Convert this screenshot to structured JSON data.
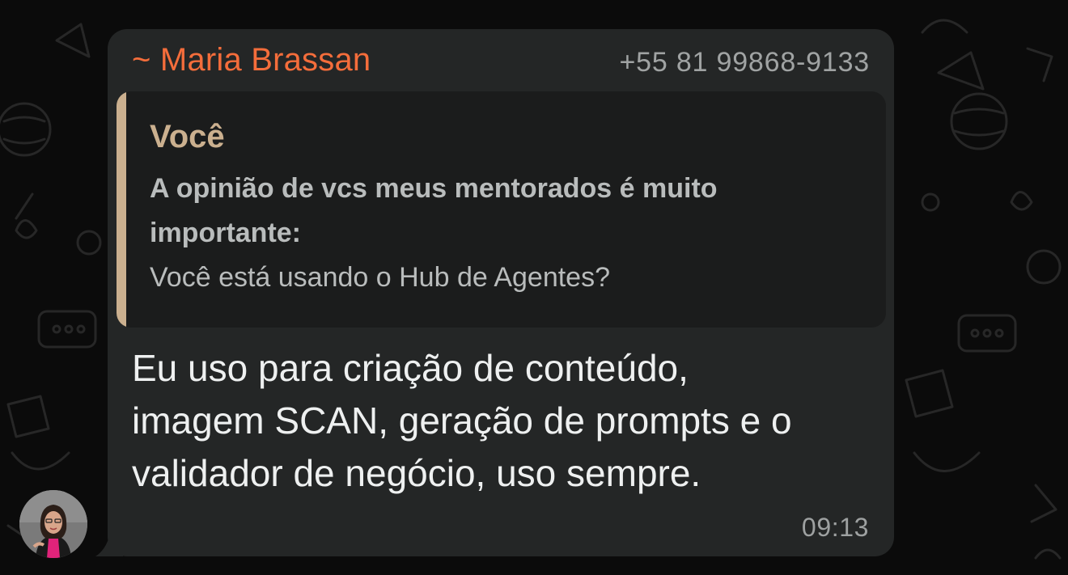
{
  "chat": {
    "sender": {
      "name": "~ Maria Brassan",
      "phone": "+55 81 99868-9133",
      "name_color": "#f46d3b"
    },
    "quoted_message": {
      "author": "Você",
      "author_color": "#cbb08f",
      "bold_line_1": "A opinião de vcs meus mentorados é muito",
      "bold_line_2": "importante:",
      "text": "Você está usando o Hub de Agentes?"
    },
    "message": {
      "line_1": "Eu uso para criação de conteúdo,",
      "line_2": "imagem SCAN, geração de prompts e o",
      "line_3": "validador de negócio, uso sempre."
    },
    "time": "09:13"
  },
  "colors": {
    "background": "#0b0b0b",
    "bubble": "#242626",
    "quote_background": "#1b1c1c"
  },
  "icons": {
    "avatar": "sender-avatar-photo",
    "wallpaper": "chat-doodle-wallpaper"
  }
}
